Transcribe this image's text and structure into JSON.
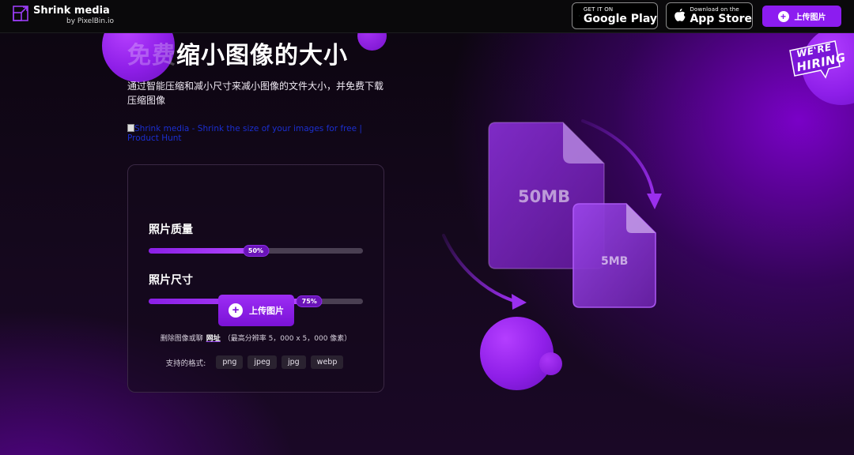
{
  "header": {
    "brand_name": "Shrink media",
    "brand_sub": "by PixelBin.io",
    "google_play": {
      "small": "GET IT ON",
      "big": "Google Play"
    },
    "app_store": {
      "small": "Download on the",
      "big": "App Store"
    },
    "upload_label": "上传图片"
  },
  "hero": {
    "title_dim": "免费",
    "title_main": "缩小图像的大小",
    "subtitle": "通过智能压缩和减小尺寸来减小图像的文件大小，并免费下载压缩图像",
    "product_hunt_alt": "Shrink media - Shrink the size of your images for free | Product Hunt"
  },
  "card": {
    "quality": {
      "label": "照片质量",
      "value": 50,
      "display": "50%"
    },
    "size": {
      "label": "照片尺寸",
      "value": 75,
      "display": "75%"
    },
    "upload_label": "上传图片",
    "url_prefix": "删除图像或聊",
    "url_link": "网址",
    "url_suffix": "（最高分辨率 5，000 x 5，000 像素）",
    "formats_label": "支持的格式:",
    "formats": [
      "png",
      "jpeg",
      "jpg",
      "webp"
    ]
  },
  "illustration": {
    "big_file": "50MB",
    "small_file": "5MB"
  },
  "hiring": {
    "line1": "WE'RE",
    "line2": "HIRING"
  },
  "colors": {
    "accent": "#8c1cf0",
    "bg": "#0c0610"
  }
}
